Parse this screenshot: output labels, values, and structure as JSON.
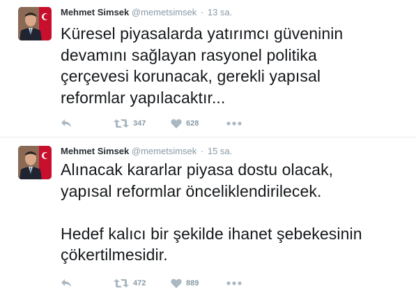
{
  "tweets": [
    {
      "name": "Mehmet Simsek",
      "handle": "@memetsimsek",
      "separator": "·",
      "time": "13 sa.",
      "text": "Küresel piyasalarda yatırımcı güveninin\ndevamını sağlayan rasyonel politika\nçerçevesi korunacak, gerekli yapısal\nreformlar yapılacaktır...",
      "retweets": "347",
      "likes": "628"
    },
    {
      "name": "Mehmet Simsek",
      "handle": "@memetsimsek",
      "separator": "·",
      "time": "15 sa.",
      "text": "Alınacak kararlar piyasa dostu olacak,\nyapısal reformlar önceliklendirilecek.\n\nHedef kalıcı bir şekilde ihanet şebekesinin\nçökertilmesidir.",
      "retweets": "472",
      "likes": "889"
    }
  ],
  "icons": {
    "reply": "reply-icon",
    "retweet": "retweet-icon",
    "like": "heart-icon",
    "more": "more-icon",
    "avatar": "profile-avatar-with-flag"
  },
  "colors": {
    "text": "#14171a",
    "muted": "#8899a6",
    "icon": "#aab8c2",
    "divider": "#e6ecf0",
    "flag_red": "#e30a17"
  }
}
